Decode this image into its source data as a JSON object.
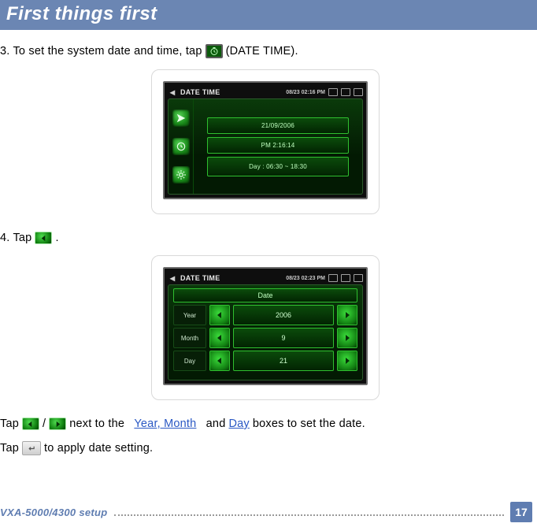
{
  "banner": {
    "title": "First things first"
  },
  "step3": {
    "prefix": "3. To set the system date and time, tap",
    "suffix": "(DATE TIME)."
  },
  "step4": {
    "text": "4. Tap",
    "period": "."
  },
  "screen1": {
    "titlebar_label": "DATE TIME",
    "titlebar_time": "08/23  02:16 PM",
    "line1": "21/09/2006",
    "line2": "PM 2:16:14",
    "line3": "Day : 06:30 ~ 18:30"
  },
  "screen2": {
    "titlebar_label": "DATE TIME",
    "titlebar_time": "08/23  02:23 PM",
    "header": "Date",
    "rows": [
      {
        "label": "Year",
        "value": "2006"
      },
      {
        "label": "Month",
        "value": "9"
      },
      {
        "label": "Day",
        "value": "21"
      }
    ]
  },
  "para_arrows": {
    "tap": "Tap",
    "slash": "/",
    "next_to": "next to the",
    "ym": "Year, Month",
    "and": "and",
    "day": "Day",
    "rest": "boxes to set the date."
  },
  "para_apply": {
    "tap": "Tap",
    "rest": "to apply date setting."
  },
  "footer": {
    "title": "VXA-5000/4300 setup",
    "page": "17"
  }
}
